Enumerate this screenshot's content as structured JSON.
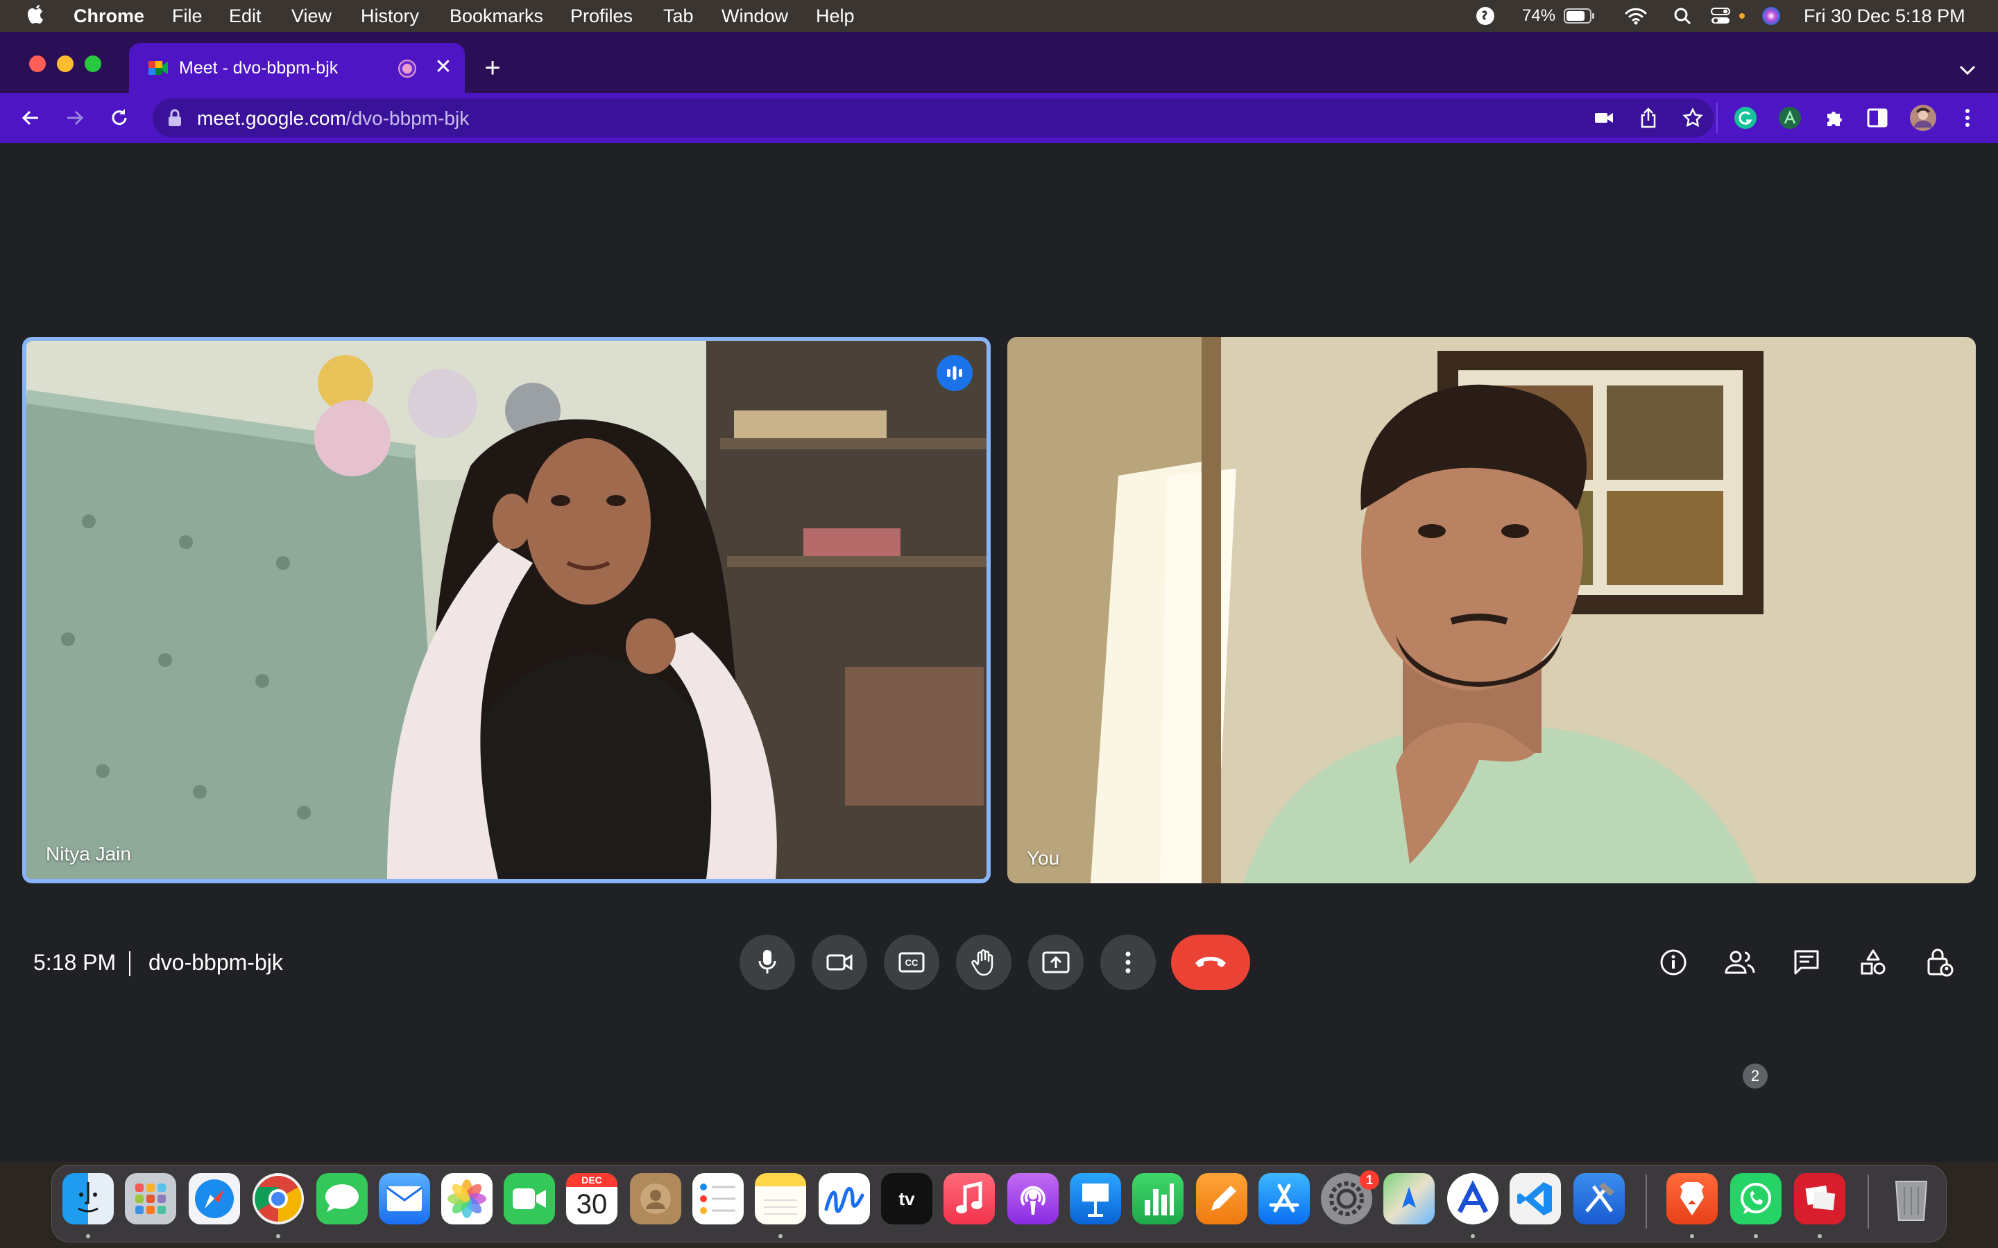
{
  "menubar": {
    "app_name": "Chrome",
    "items": [
      "File",
      "Edit",
      "View",
      "History",
      "Bookmarks",
      "Profiles",
      "Tab",
      "Window",
      "Help"
    ],
    "battery_percent": "74%",
    "datetime": "Fri 30 Dec  5:18 PM"
  },
  "browser": {
    "tab_title": "Meet - dvo-bbpm-bjk",
    "url_host": "meet.google.com",
    "url_path": "/dvo-bbpm-bjk"
  },
  "meet": {
    "participants": [
      {
        "name": "Nitya Jain",
        "speaking": true
      },
      {
        "name": "You",
        "speaking": false
      }
    ],
    "time": "5:18 PM",
    "meeting_code": "dvo-bbpm-bjk",
    "people_count": "2",
    "colors": {
      "background": "#202124",
      "control": "#3c4043",
      "leave": "#ea4335",
      "speaking_border": "#8ab4f8"
    }
  },
  "dock": {
    "calendar_month": "DEC",
    "calendar_day": "30",
    "settings_badge": "1",
    "icons": [
      "finder",
      "launchpad",
      "safari",
      "chrome",
      "messages",
      "mail",
      "photos",
      "facetime",
      "calendar",
      "contacts",
      "reminders",
      "notes",
      "freeform",
      "apple-tv",
      "music",
      "podcasts",
      "keynote",
      "numbers",
      "pages",
      "app-store",
      "system-settings",
      "maps",
      "instruments",
      "vscode",
      "xcode",
      "brave",
      "whatsapp",
      "photo-booth",
      "trash"
    ]
  }
}
